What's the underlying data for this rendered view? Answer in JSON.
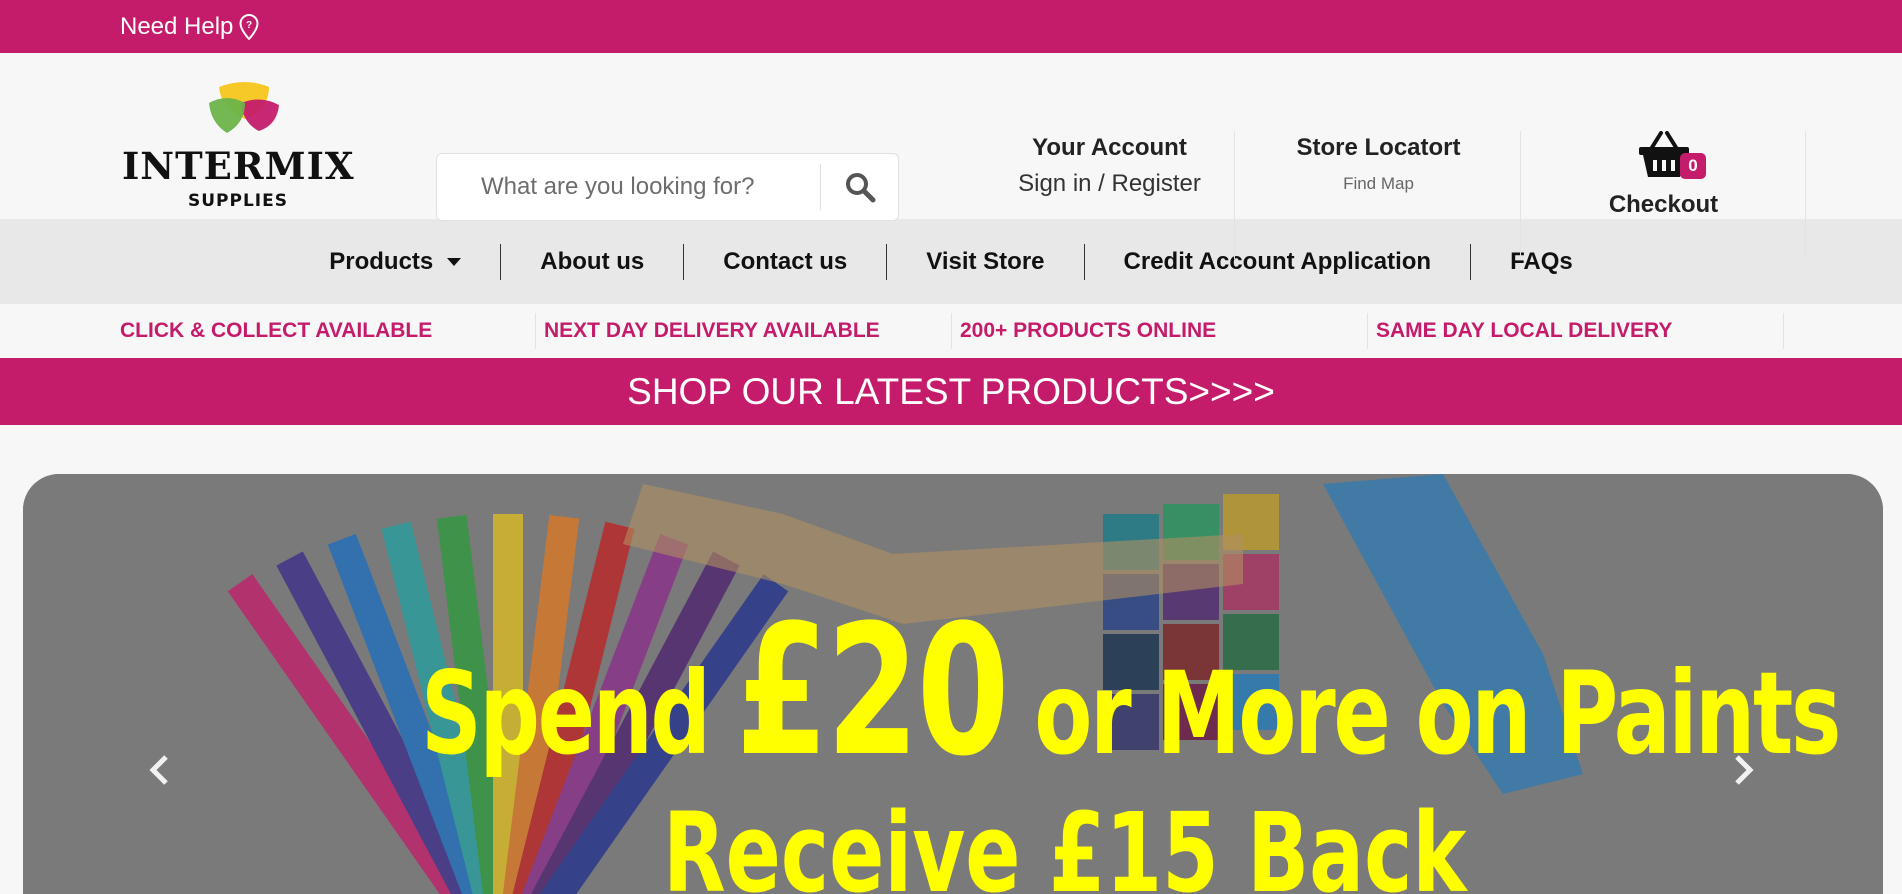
{
  "topbar": {
    "need_help": "Need Help",
    "help_icon": "location-pin-icon"
  },
  "brand": {
    "name": "INTERMIX",
    "subtitle": "SUPPLIES"
  },
  "search": {
    "placeholder": "What are you looking for?",
    "icon": "search-icon"
  },
  "account": {
    "title": "Your Account",
    "link": "Sign in / Register"
  },
  "store": {
    "title": "Store Locatort",
    "link": "Find Map"
  },
  "cart": {
    "count": "0",
    "label": "Checkout",
    "icon": "basket-icon"
  },
  "nav": {
    "items": [
      "Products",
      "About us",
      "Contact us",
      "Visit Store",
      "Credit Account Application",
      "FAQs"
    ]
  },
  "features": [
    "CLICK & COLLECT AVAILABLE",
    "NEXT DAY DELIVERY AVAILABLE",
    "200+ PRODUCTS ONLINE",
    "SAME DAY LOCAL DELIVERY"
  ],
  "promo_bar": "SHOP OUR LATEST PRODUCTS>>>>",
  "banner": {
    "line1_a": "Spend",
    "line1_b": "£20",
    "line1_c": "or More on Paints",
    "line2_a": "Receive",
    "line2_b": "£15",
    "line2_c": "Back",
    "prev_icon": "chevron-left-icon",
    "next_icon": "chevron-right-icon"
  },
  "colors": {
    "brand": "#c51b6b",
    "banner_text": "#ffff00"
  }
}
